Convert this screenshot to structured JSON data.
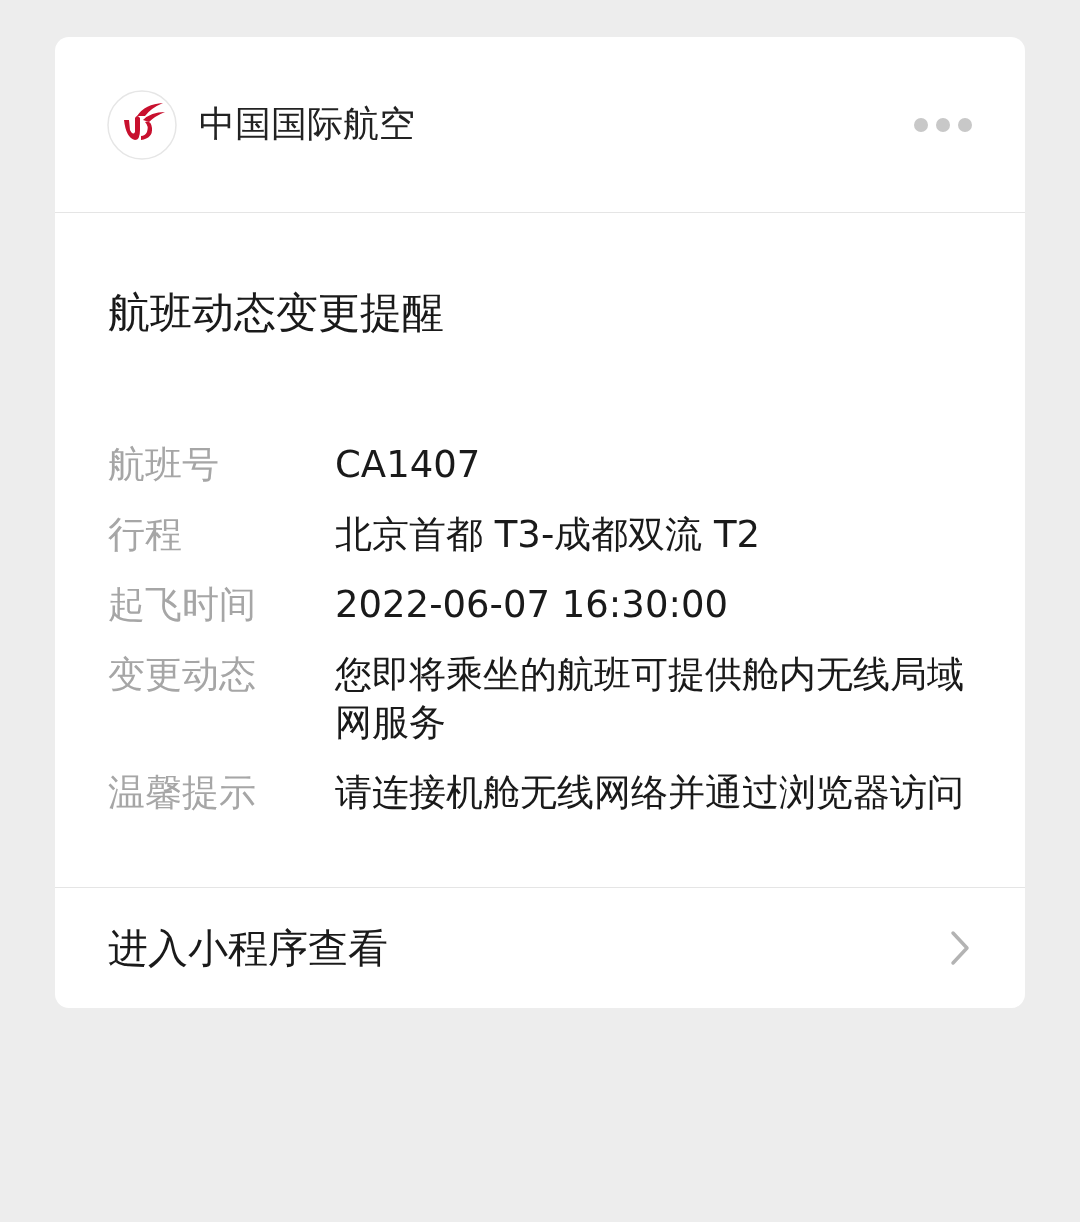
{
  "header": {
    "account_name": "中国国际航空"
  },
  "title": "航班动态变更提醒",
  "fields": [
    {
      "label": "航班号",
      "value": "CA1407"
    },
    {
      "label": "行程",
      "value": "北京首都 T3-成都双流 T2"
    },
    {
      "label": "起飞时间",
      "value": "2022-06-07 16:30:00"
    },
    {
      "label": "变更动态",
      "value": "您即将乘坐的航班可提供舱内无线局域网服务"
    },
    {
      "label": "温馨提示",
      "value": "请连接机舱无线网络并通过浏览器访问"
    }
  ],
  "footer": {
    "link": "进入小程序查看"
  }
}
